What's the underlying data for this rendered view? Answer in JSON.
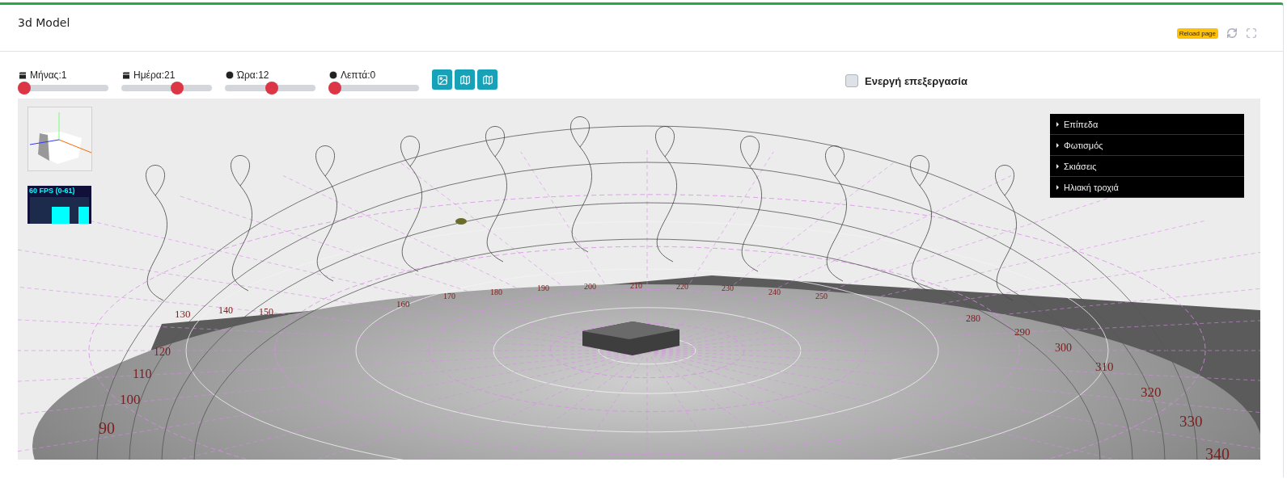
{
  "card": {
    "title": "3d Model",
    "badge": "Reload page"
  },
  "sliders": [
    {
      "kind": "date",
      "label": "Μήνας:1",
      "level": 0
    },
    {
      "kind": "date",
      "label": "Ημέρα:21",
      "level": 0.64
    },
    {
      "kind": "time",
      "label": "Ώρα:12",
      "level": 0.52
    },
    {
      "kind": "time",
      "label": "Λεπτά:0",
      "level": 0
    }
  ],
  "view_buttons": [
    {
      "kind": "image"
    },
    {
      "kind": "map"
    },
    {
      "kind": "map"
    }
  ],
  "edit_toggle": {
    "label": "Ενεργή επεξεργασία",
    "checked": false
  },
  "scene": {
    "fps": "60 FPS (0-61)",
    "menu": [
      {
        "label": "Επίπεδα"
      },
      {
        "label": "Φωτισμός"
      },
      {
        "label": "Σκιάσεις"
      },
      {
        "label": "Ηλιακή τροχιά"
      }
    ],
    "degree_labels": [
      "90",
      "100",
      "110",
      "120",
      "130",
      "140",
      "150",
      "160",
      "170",
      "180",
      "190",
      "200",
      "210",
      "220",
      "230",
      "240",
      "250",
      "280",
      "290",
      "300",
      "310",
      "320",
      "330",
      "340"
    ]
  }
}
